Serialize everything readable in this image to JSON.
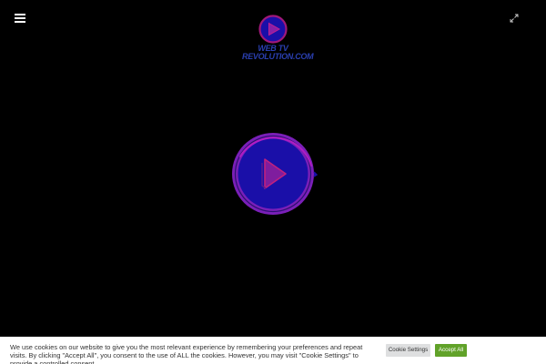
{
  "header": {
    "menu_icon": "hamburger-menu-icon",
    "expand_icon": "expand-fullscreen-icon"
  },
  "logo": {
    "line1": "WEB TV",
    "line2": "REVOLUTION.COM"
  },
  "player": {
    "play_icon": "play-icon",
    "accent_color": "#7a1fb8",
    "fill_color": "#1a0fa8",
    "ring_color": "#b01cc4"
  },
  "cookie_banner": {
    "message": "We use cookies on our website to give you the most relevant experience by remembering your preferences and repeat visits. By clicking \"Accept All\", you consent to the use of ALL the cookies. However, you may visit \"Cookie Settings\" to provide a controlled consent.",
    "settings_label": "Cookie Settings",
    "accept_label": "Accept All",
    "accept_color": "#61a229"
  }
}
